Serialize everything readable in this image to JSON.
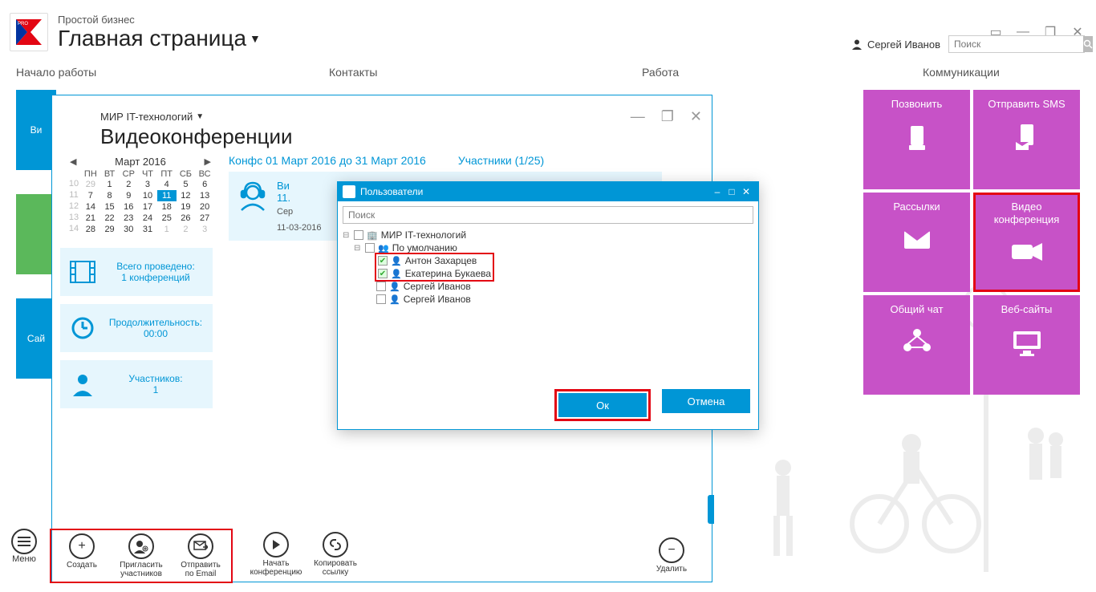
{
  "app": {
    "subtitle": "Простой бизнес",
    "title": "Главная страница"
  },
  "user": {
    "name": "Сергей Иванов"
  },
  "search_placeholder": "Поиск",
  "sections": {
    "s1": "Начало работы",
    "s2": "Контакты",
    "s3": "Работа",
    "s4": "Коммуникации"
  },
  "tiles": {
    "call": "Позвонить",
    "sms": "Отправить SMS",
    "mail": "Рассылки",
    "video1": "Видео",
    "video2": "конференция",
    "chat": "Общий чат",
    "web": "Веб-сайты"
  },
  "left": {
    "b1": "Ви",
    "b2": "",
    "b3": "Сай"
  },
  "vc": {
    "org": "МИР IT-технологий",
    "title": "Видеоконференции",
    "range_label": "Конфс 01 Март 2016 до 31 Март 2016",
    "participants_link": "Участники (1/25)",
    "cal": {
      "month": "Март 2016",
      "dh": [
        "ПН",
        "ВТ",
        "СР",
        "ЧТ",
        "ПТ",
        "СБ",
        "ВС"
      ],
      "weeks": [
        {
          "wn": "10",
          "d": [
            {
              "v": "29",
              "o": 1
            },
            {
              "v": "1"
            },
            {
              "v": "2"
            },
            {
              "v": "3"
            },
            {
              "v": "4"
            },
            {
              "v": "5"
            },
            {
              "v": "6"
            }
          ]
        },
        {
          "wn": "11",
          "d": [
            {
              "v": "7"
            },
            {
              "v": "8"
            },
            {
              "v": "9"
            },
            {
              "v": "10"
            },
            {
              "v": "11",
              "sel": 1
            },
            {
              "v": "12"
            },
            {
              "v": "13"
            }
          ]
        },
        {
          "wn": "12",
          "d": [
            {
              "v": "14"
            },
            {
              "v": "15"
            },
            {
              "v": "16"
            },
            {
              "v": "17"
            },
            {
              "v": "18"
            },
            {
              "v": "19"
            },
            {
              "v": "20"
            }
          ]
        },
        {
          "wn": "13",
          "d": [
            {
              "v": "21"
            },
            {
              "v": "22"
            },
            {
              "v": "23"
            },
            {
              "v": "24"
            },
            {
              "v": "25"
            },
            {
              "v": "26"
            },
            {
              "v": "27"
            }
          ]
        },
        {
          "wn": "14",
          "d": [
            {
              "v": "28"
            },
            {
              "v": "29"
            },
            {
              "v": "30"
            },
            {
              "v": "31"
            },
            {
              "v": "1",
              "o": 1
            },
            {
              "v": "2",
              "o": 1
            },
            {
              "v": "3",
              "o": 1
            }
          ]
        }
      ]
    },
    "stats": {
      "total_l1": "Всего проведено:",
      "total_l2": "1 конференций",
      "dur_l1": "Продолжительность:",
      "dur_l2": "00:00",
      "part_l1": "Участников:",
      "part_l2": "1"
    },
    "conf": {
      "title": "Ви",
      "time": "11.",
      "sub": "Сер",
      "date": "11-03-2016"
    },
    "toolbar": {
      "menu": "Меню",
      "create": "Создать",
      "invite_l1": "Пригласить",
      "invite_l2": "участников",
      "email_l1": "Отправить",
      "email_l2": "по Email",
      "start_l1": "Начать",
      "start_l2": "конференцию",
      "copy_l1": "Копировать",
      "copy_l2": "ссылку",
      "delete": "Удалить"
    }
  },
  "dialog": {
    "title": "Пользователи",
    "search_placeholder": "Поиск",
    "tree": {
      "root": "МИР IT-технологий",
      "group": "По умолчанию",
      "u1": "Антон Захарцев",
      "u2": "Екатерина Букаева",
      "u3": "Сергей Иванов",
      "u4": "Сергей Иванов"
    },
    "ok": "Ок",
    "cancel": "Отмена"
  }
}
